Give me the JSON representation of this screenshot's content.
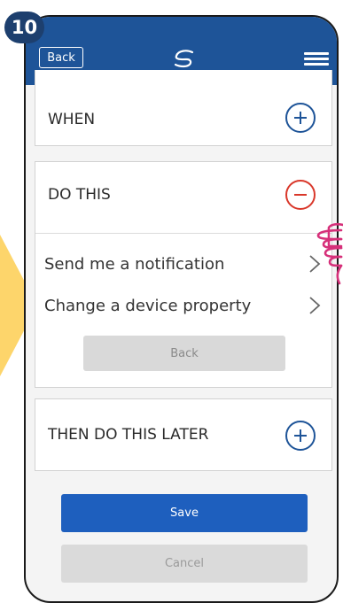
{
  "step": {
    "number": "10"
  },
  "header": {
    "back_label": "Back",
    "logo_icon": "logo-icon",
    "menu_icon": "hamburger-menu-icon",
    "background_color": "#1e5498"
  },
  "when": {
    "title": "WHEN",
    "toggle_icon": "plus-circle-icon"
  },
  "do_this": {
    "title": "DO THIS",
    "toggle_icon": "minus-circle-icon",
    "options": [
      {
        "label": "Send me a notification",
        "icon": "chevron-right-icon"
      },
      {
        "label": "Change a device property",
        "icon": "chevron-right-icon"
      }
    ],
    "back_label": "Back"
  },
  "then_later": {
    "title": "THEN DO THIS LATER",
    "toggle_icon": "plus-circle-icon"
  },
  "actions": {
    "save_label": "Save",
    "cancel_label": "Cancel"
  },
  "colors": {
    "accent": "#1e5fbe",
    "minus": "#d9372a",
    "pointer_arrow": "#fdd56b",
    "hand": "#d6307a"
  }
}
